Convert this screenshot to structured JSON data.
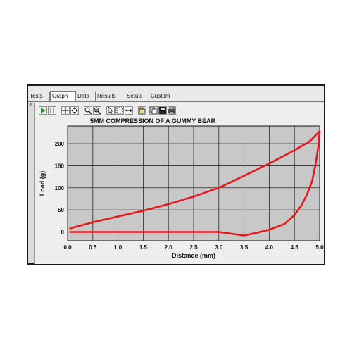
{
  "tabs": [
    "Tests",
    "Graph",
    "Data",
    "Results",
    "Setup",
    "Custom"
  ],
  "active_tab": "Graph",
  "toolbar": {
    "icons": [
      "play-icon",
      "pause-icon",
      "crosshair-icon",
      "move-icon",
      "zoom-in-icon",
      "zoom-out-icon",
      "pointer-icon",
      "select-box-icon",
      "fit-width-icon",
      "open-icon",
      "copy-icon",
      "save-icon",
      "print-icon"
    ]
  },
  "close_glyph": "×",
  "chart_data": {
    "type": "line",
    "title": "5MM COMPRESSION OF A GUMMY BEAR",
    "xlabel": "Distance (mm)",
    "ylabel": "Load (g)",
    "xlim": [
      0.0,
      5.0
    ],
    "ylim": [
      -20,
      240
    ],
    "x_ticks": [
      "0.0",
      "0.5",
      "1.0",
      "1.5",
      "2.0",
      "2.5",
      "3.0",
      "3.5",
      "4.0",
      "4.5",
      "5.0"
    ],
    "y_ticks": [
      "0",
      "50",
      "100",
      "150",
      "200"
    ],
    "grid": true,
    "colors": {
      "series": "#e8181a",
      "plot_bg": "#c8c8c8",
      "grid": "#2a2a2a"
    },
    "series": [
      {
        "x": [
          0.05,
          0.5,
          1.0,
          1.5,
          2.0,
          2.5,
          3.0,
          3.5,
          4.0,
          4.5,
          4.8,
          5.0
        ],
        "y": [
          8,
          22,
          35,
          48,
          63,
          80,
          100,
          127,
          155,
          185,
          205,
          228
        ]
      },
      {
        "x": [
          5.0,
          4.98,
          4.93,
          4.85,
          4.75,
          4.65,
          4.5,
          4.3,
          4.0,
          3.75,
          3.5,
          3.25,
          3.0,
          2.0,
          1.0,
          0.05
        ],
        "y": [
          228,
          200,
          160,
          115,
          85,
          62,
          38,
          18,
          5,
          -2,
          -8,
          -4,
          0,
          0,
          0,
          0
        ]
      }
    ]
  }
}
